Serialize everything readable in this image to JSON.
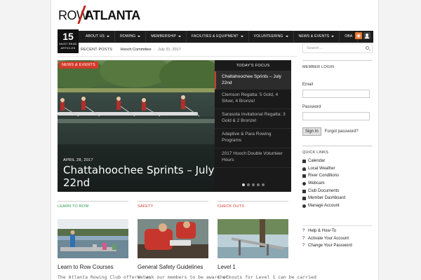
{
  "logo": {
    "part1": "ROW",
    "part2": "ATLANTA"
  },
  "datebox": {
    "day": "15",
    "label": "MUST READ ARTICLES"
  },
  "nav": {
    "items": [
      {
        "label": "ABOUT US",
        "has_caret": true
      },
      {
        "label": "ROWING",
        "has_caret": true
      },
      {
        "label": "MEMBERSHIP",
        "has_caret": true
      },
      {
        "label": "FACILITIES & EQUIPMENT",
        "has_caret": true
      },
      {
        "label": "VOLUNTEERING",
        "has_caret": true
      },
      {
        "label": "NEWS & EVENTS",
        "has_caret": true
      },
      {
        "label": "OBA",
        "has_caret": false
      }
    ],
    "rss_icon": "rss-icon",
    "user_icon": "user-icon"
  },
  "recent": {
    "label": "RECENT POSTS",
    "title": "Hooch Committee",
    "date": "July 31, 2017"
  },
  "search": {
    "placeholder": "Search ..."
  },
  "slider": {
    "badge": "NEWS & EVENTS",
    "date": "APRIL 28, 2017",
    "title": "Chattahoochee Sprints – July 22nd",
    "focus_heading": "TODAY'S FOCUS",
    "focus_items": [
      "Chattahoochee Sprints – July 22nd",
      "Clemson Regatta: 5 Gold, 4 Silver, 4 Bronze!",
      "Sarasota Invitational Regatta: 3 Gold & 2 Bronze!",
      "Adaptive & Para Rowing Programs",
      "2017 Hooch Double Volunteer Hours"
    ]
  },
  "columns": [
    {
      "category": "LEARN TO ROW",
      "title": "Learn to Row Courses",
      "excerpt": "The Atlanta Rowing Club offers two"
    },
    {
      "category": "SAFETY",
      "title": "General Safety Guidelines",
      "excerpt": "We ask our members to be aware of"
    },
    {
      "category": "CHECK OUTS",
      "title": "Level 1",
      "excerpt": "Checkouts for Level 1 can be carried"
    }
  ],
  "sidebar": {
    "login_heading": "MEMBER LOGIN",
    "email_label": "Email",
    "password_label": "Password",
    "sign_in": "Sign In",
    "forgot": "Forgot password?",
    "quick_heading": "QUICK LINKS",
    "quick_links": [
      {
        "label": "Calendar",
        "icon": "calendar-icon"
      },
      {
        "label": "Local Weather",
        "icon": "cloud-icon"
      },
      {
        "label": "River Conditions",
        "icon": "car-icon"
      },
      {
        "label": "Webcam",
        "icon": "camera-icon"
      },
      {
        "label": "Club Documents",
        "icon": "document-icon"
      },
      {
        "label": "Member Dashboard",
        "icon": "dashboard-icon"
      },
      {
        "label": "Manage Account",
        "icon": "gear-icon"
      }
    ],
    "help_links": [
      {
        "label": "Help & How-To",
        "icon": "question-icon"
      },
      {
        "label": "Activate Your Account",
        "icon": "question-icon"
      },
      {
        "label": "Change Your Password",
        "icon": "question-icon"
      }
    ]
  },
  "colors": {
    "accent_red": "#d23b2b",
    "nav_bg": "#1d1d1d",
    "green": "#2a9a4a"
  }
}
